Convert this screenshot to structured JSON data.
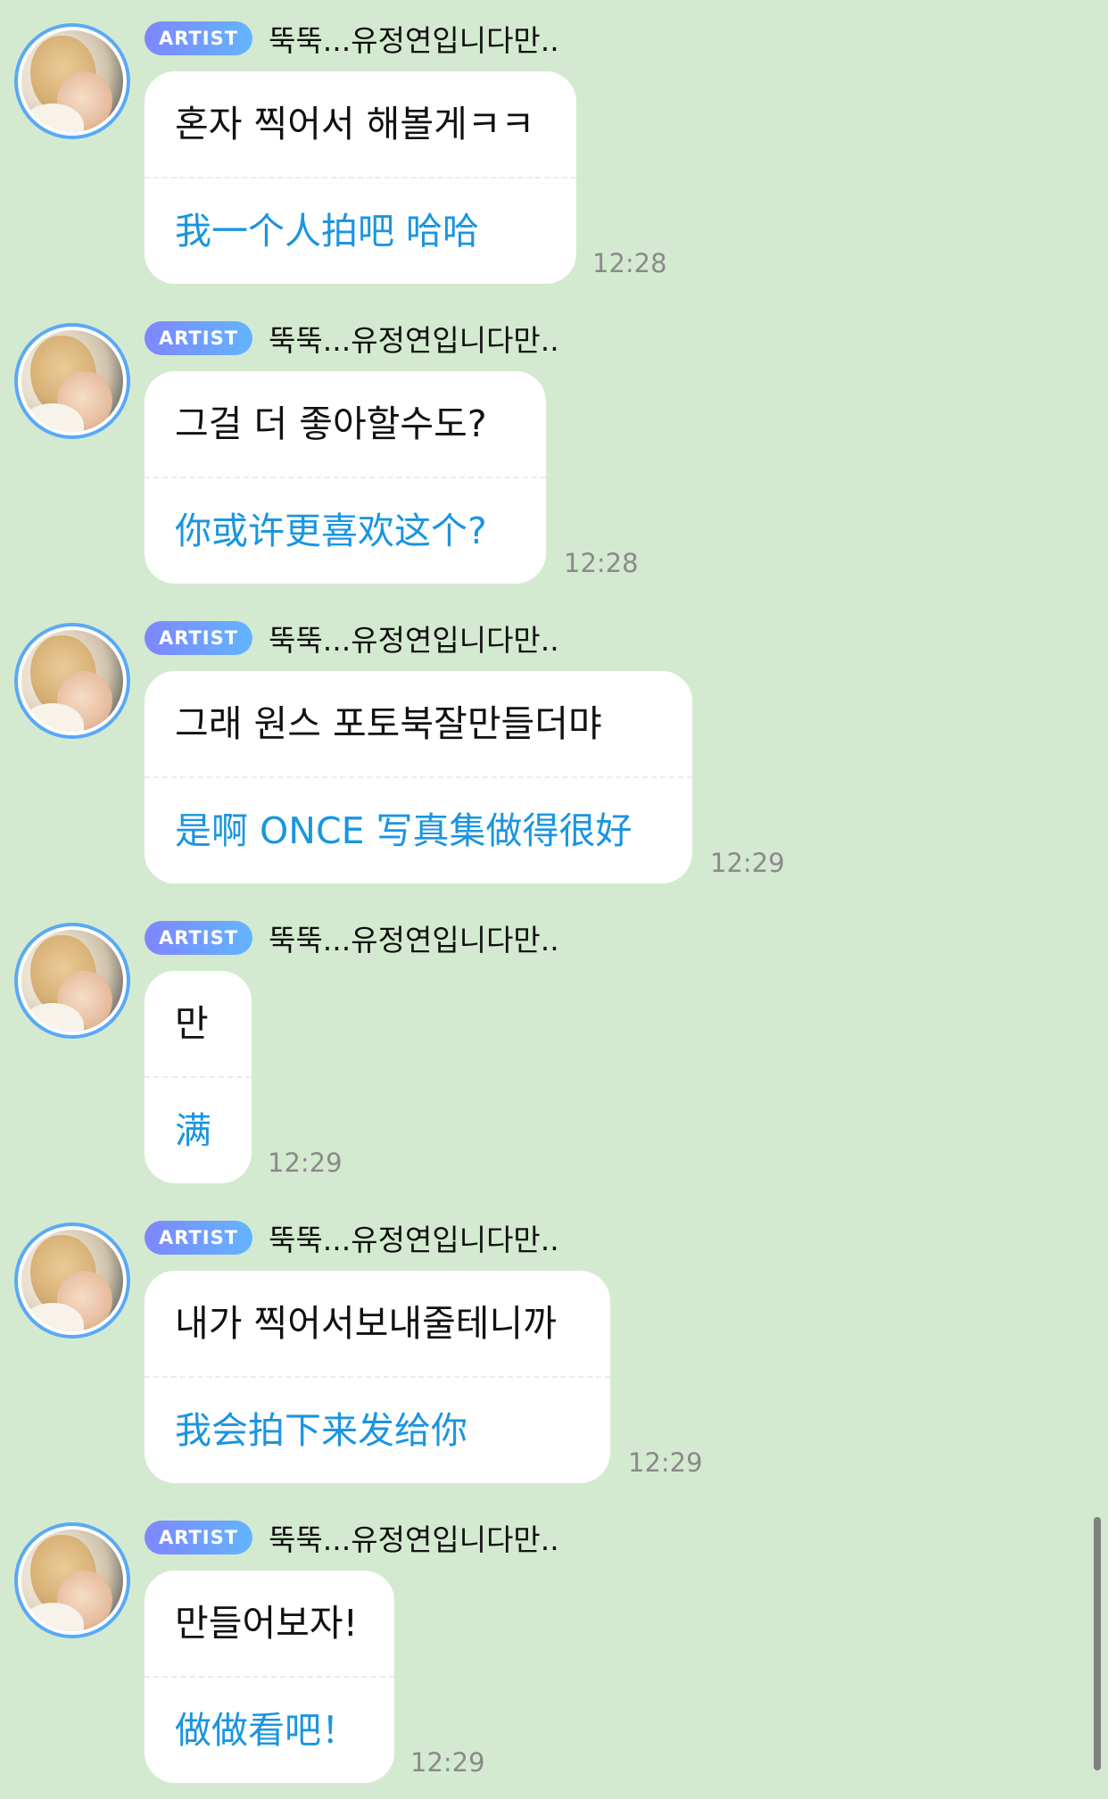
{
  "messages": [
    {
      "badge": "ARTIST",
      "sender": "뚝뚝...유정연입니다만..",
      "korean": "혼자 찍어서 해볼게ㅋㅋ",
      "chinese": "我一个人拍吧 哈哈",
      "time": "12:28"
    },
    {
      "badge": "ARTIST",
      "sender": "뚝뚝...유정연입니다만..",
      "korean": "그걸 더 좋아할수도?",
      "chinese": "你或许更喜欢这个?",
      "time": "12:28"
    },
    {
      "badge": "ARTIST",
      "sender": "뚝뚝...유정연입니다만..",
      "korean": "그래 원스 포토북잘만들더먀",
      "chinese": "是啊 ONCE 写真集做得很好",
      "time": "12:29"
    },
    {
      "badge": "ARTIST",
      "sender": "뚝뚝...유정연입니다만..",
      "korean": "만",
      "chinese": "满",
      "time": "12:29"
    },
    {
      "badge": "ARTIST",
      "sender": "뚝뚝...유정연입니다만..",
      "korean": "내가  찍어서보내줄테니까",
      "chinese": "我会拍下来发给你",
      "time": "12:29"
    },
    {
      "badge": "ARTIST",
      "sender": "뚝뚝...유정연입니다만..",
      "korean": "만들어보자!",
      "chinese": "做做看吧！",
      "time": "12:29"
    }
  ],
  "colors": {
    "background": "#d4ead0",
    "translation_text": "#1a95e0",
    "avatar_ring": "#5aa9f6",
    "badge_gradient_start": "#7f86ff",
    "badge_gradient_end": "#62b5ff"
  }
}
